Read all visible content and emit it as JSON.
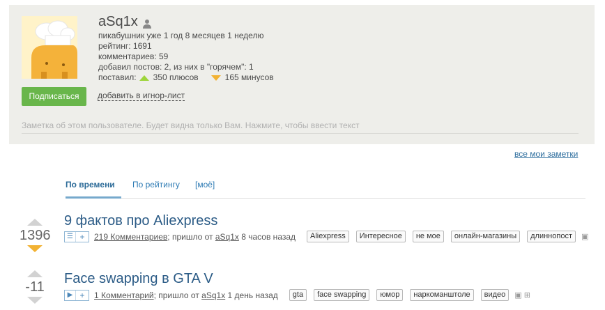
{
  "profile": {
    "username": "aSq1x",
    "user_icon": "user-icon",
    "stats": {
      "membership": "пикабушник уже 1 год 8 месяцев 1 неделю",
      "rating": "рейтинг: 1691",
      "comments": "комментариев: 59",
      "posts": "добавил постов: 2, из них в \"горячем\": 1",
      "votes_label": "поставил:",
      "plus": "350 плюсов",
      "minus": "165 минусов"
    },
    "subscribe_label": "Подписаться",
    "ignore_label": "добавить в игнор-лист",
    "note_placeholder": "Заметка об этом пользователе. Будет видна только Вам. Нажмите, чтобы ввести текст"
  },
  "all_notes_label": "все мои заметки",
  "tabs": [
    {
      "label": "По времени",
      "active": true
    },
    {
      "label": "По рейтингу",
      "active": false
    },
    {
      "label": "[моё]",
      "active": false
    }
  ],
  "posts": [
    {
      "rating": "1396",
      "title": "9 фактов про Aliexpress",
      "type_icon": "list-icon",
      "comments": "219 Комментариев",
      "from_prefix": "; пришло от",
      "author": "aSq1x",
      "time": "8 часов назад",
      "tags": [
        "Aliexpress",
        "Интересное",
        "не мое",
        "онлайн-магазины",
        "длиннопост"
      ]
    },
    {
      "rating": "-11",
      "title": "Face swapping в GTA V",
      "type_icon": "play-icon",
      "comments": "1 Комментарий",
      "from_prefix": "; пришло от",
      "author": "aSq1x",
      "time": "1 день назад",
      "tags": [
        "gta",
        "face swapping",
        "юмор",
        "наркоманштоле",
        "видео"
      ]
    }
  ],
  "colors": {
    "subscribe_green": "#69b64b",
    "link_blue": "#2e6e9e",
    "plus_green": "#9dd53a",
    "minus_orange": "#f2b233"
  }
}
